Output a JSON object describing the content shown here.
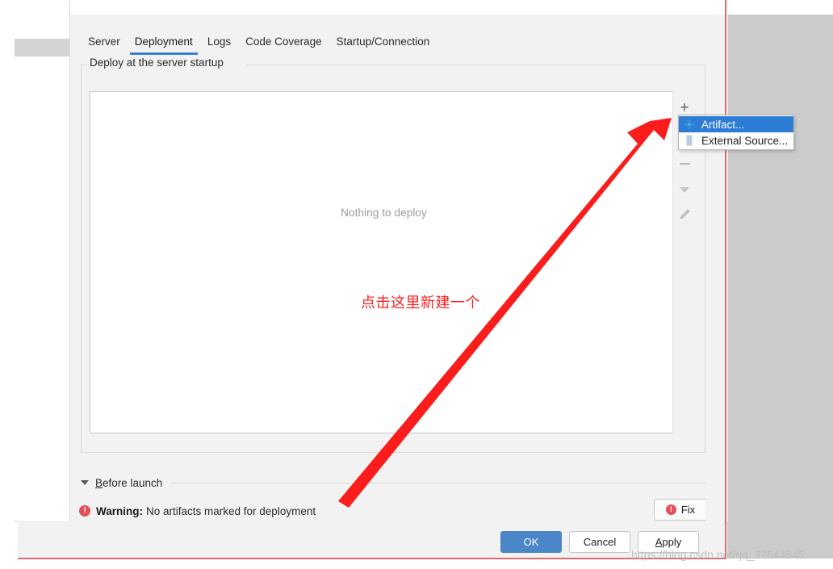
{
  "dialog": {
    "tabs": [
      {
        "label": "Server",
        "active": false
      },
      {
        "label": "Deployment",
        "active": true
      },
      {
        "label": "Logs",
        "active": false
      },
      {
        "label": "Code Coverage",
        "active": false
      },
      {
        "label": "Startup/Connection",
        "active": false
      }
    ],
    "group_title": "Deploy at the server startup",
    "list_empty_text": "Nothing to deploy",
    "toolbar": {
      "add_icon": "plus-icon",
      "add_label": "+",
      "remove_icon": "minus-icon",
      "move_down_icon": "caret-down-icon",
      "edit_icon": "pencil-icon"
    },
    "menu": {
      "items": [
        {
          "label": "Artifact...",
          "icon": "artifact-icon",
          "selected": true
        },
        {
          "label": "External Source...",
          "icon": "external-source-icon",
          "selected": false
        }
      ]
    },
    "before_launch": {
      "triangle_icon": "caret-down-icon",
      "label_first_char": "B",
      "label_rest": "efore launch"
    },
    "warning": {
      "icon": "error-circle-icon",
      "icon_glyph": "!",
      "label": "Warning:",
      "text": "No artifacts marked for deployment"
    },
    "fix_button": {
      "icon": "error-circle-icon",
      "icon_glyph": "!",
      "label": "Fix"
    },
    "buttons": [
      {
        "label": "OK",
        "style": "primary",
        "mnemonic": ""
      },
      {
        "label": "Cancel",
        "style": "normal",
        "mnemonic": ""
      },
      {
        "label": "Apply",
        "style": "normal",
        "mnemonic": "A"
      }
    ]
  },
  "annotation": {
    "text": "点击这里新建一个",
    "arrow_color": "#fb1c1c",
    "text_color": "#fb2020"
  },
  "watermark": {
    "text": "https://blog.csdn.net/qq_37644845"
  },
  "colors": {
    "accent_blue": "#3c7fd0",
    "menu_selected": "#2d7cd6",
    "primary_button": "#4a86c8",
    "warning_red": "#e2505a",
    "annotation_red": "#fb2020",
    "panel_bg": "#f2f2f2",
    "right_plate": "#cbcbcb"
  }
}
